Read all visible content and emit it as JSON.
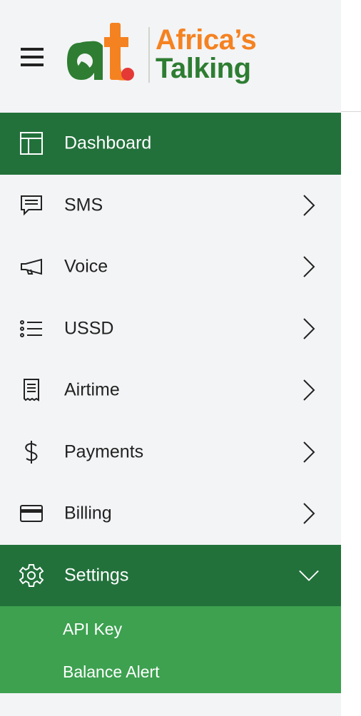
{
  "brand": {
    "line1": "Africa’s",
    "line2": "Talking",
    "colors": {
      "orange": "#f58220",
      "green": "#2e7d32",
      "red": "#e53935"
    }
  },
  "colors": {
    "active_bg": "#22713b",
    "submenu_bg": "#3da150",
    "sidebar_bg": "#f3f4f6"
  },
  "menu": {
    "items": [
      {
        "label": "Dashboard",
        "icon": "dashboard-icon",
        "state": "active"
      },
      {
        "label": "SMS",
        "icon": "chat-icon",
        "state": "collapsed"
      },
      {
        "label": "Voice",
        "icon": "megaphone-icon",
        "state": "collapsed"
      },
      {
        "label": "USSD",
        "icon": "list-icon",
        "state": "collapsed"
      },
      {
        "label": "Airtime",
        "icon": "receipt-icon",
        "state": "collapsed"
      },
      {
        "label": "Payments",
        "icon": "dollar-icon",
        "state": "collapsed"
      },
      {
        "label": "Billing",
        "icon": "credit-card-icon",
        "state": "collapsed"
      },
      {
        "label": "Settings",
        "icon": "gear-icon",
        "state": "expanded"
      }
    ],
    "settings_sub": [
      {
        "label": "API Key"
      },
      {
        "label": "Balance Alert"
      }
    ]
  }
}
